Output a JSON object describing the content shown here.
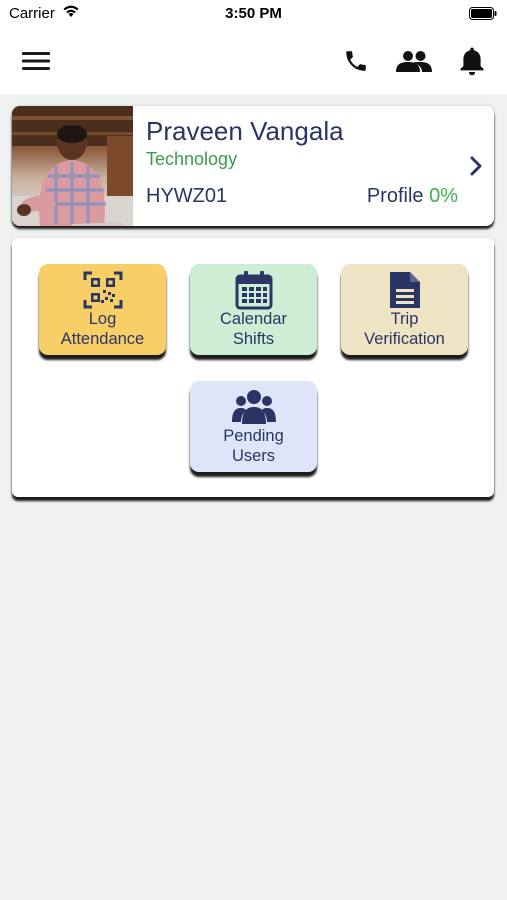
{
  "status_bar": {
    "carrier": "Carrier",
    "time": "3:50 PM"
  },
  "nav": {
    "icons": [
      "menu-icon",
      "phone-icon",
      "people-icon",
      "bell-icon"
    ]
  },
  "profile": {
    "name": "Praveen Vangala",
    "department": "Technology",
    "code": "HYWZ01",
    "profile_label": "Profile",
    "profile_percent": "0%"
  },
  "tiles": [
    {
      "line1": "Log",
      "line2": "Attendance",
      "icon": "qr-code-icon",
      "color": "#f8cf67"
    },
    {
      "line1": "Calendar",
      "line2": "Shifts",
      "icon": "calendar-icon",
      "color": "#cdeed4"
    },
    {
      "line1": "Trip",
      "line2": "Verification",
      "icon": "document-icon",
      "color": "#eee4c3"
    },
    {
      "line1": "Pending",
      "line2": "Users",
      "icon": "users-icon",
      "color": "#dfe5f8"
    }
  ],
  "colors": {
    "primary": "#2a3565",
    "accent_green": "#3cb04a",
    "background": "#eef1ef"
  }
}
